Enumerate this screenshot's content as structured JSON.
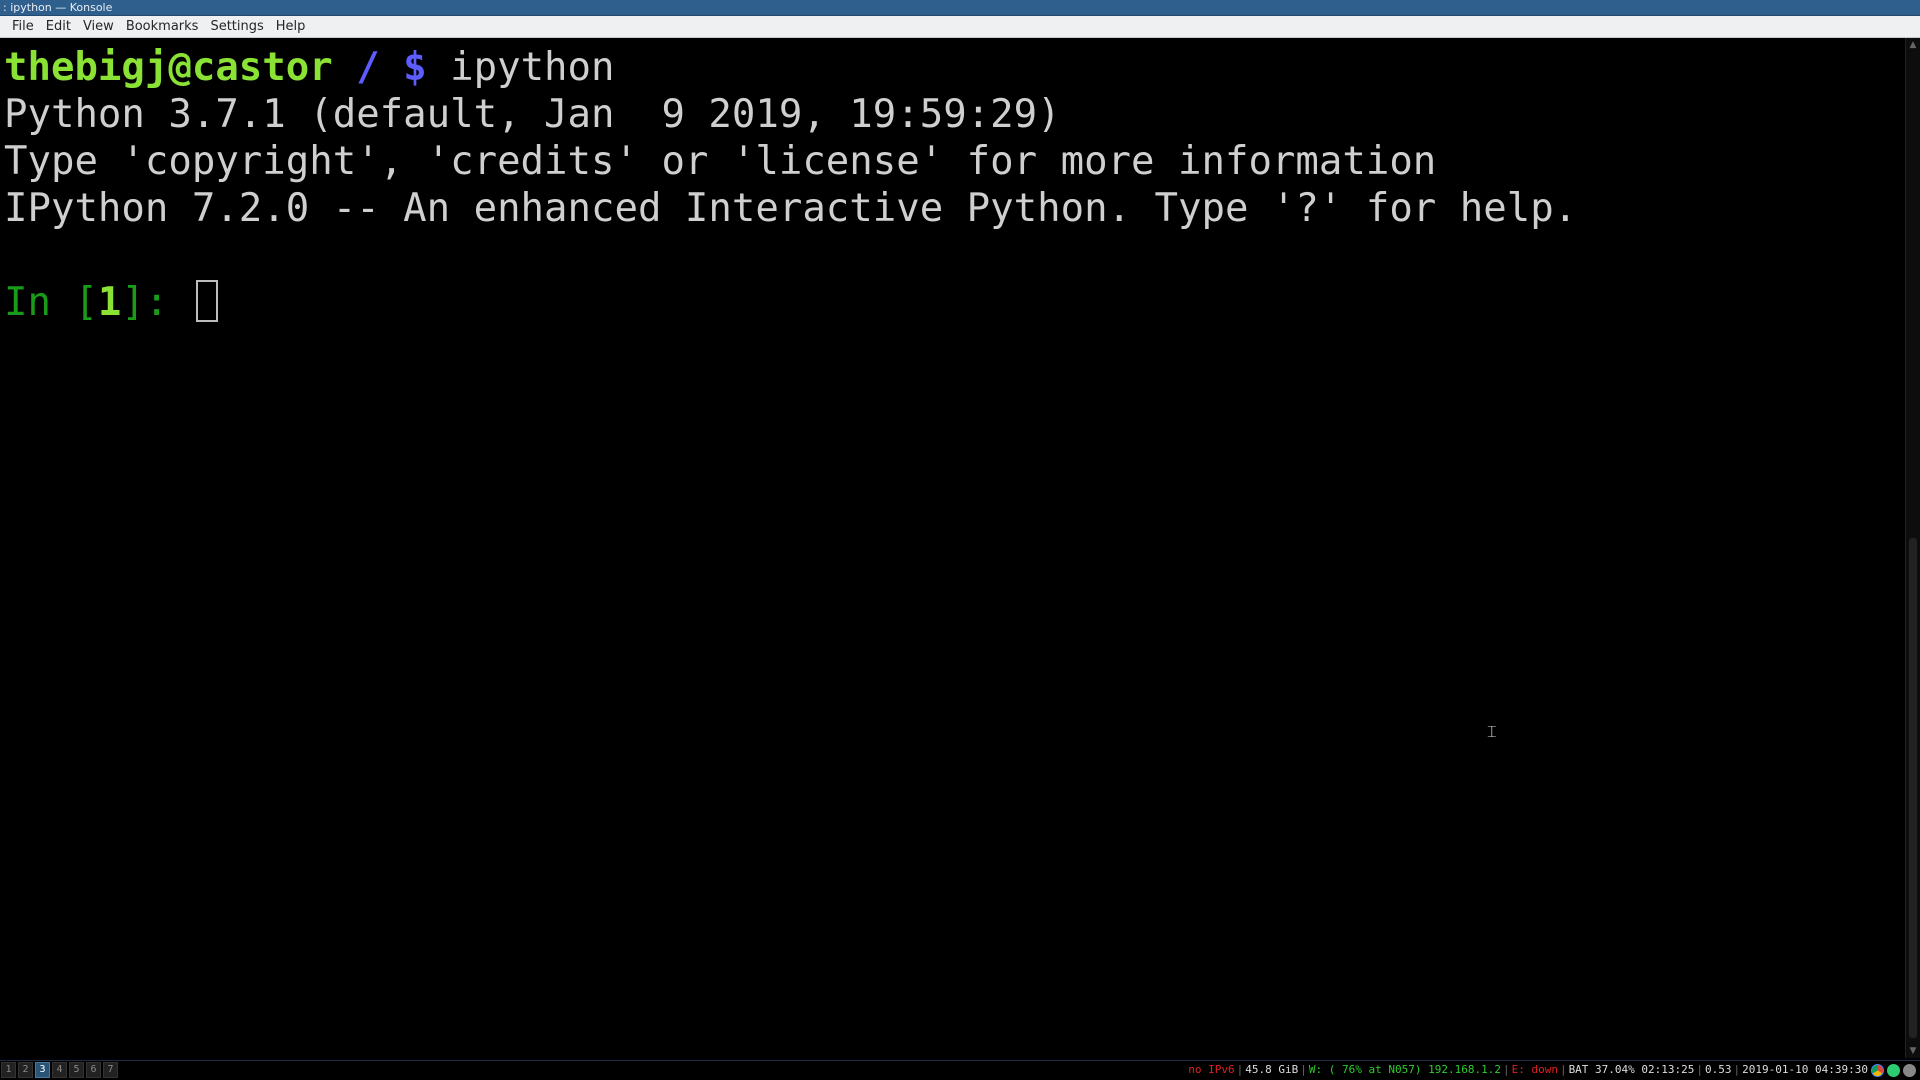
{
  "window": {
    "title": ": ipython — Konsole"
  },
  "menubar": {
    "items": [
      "File",
      "Edit",
      "View",
      "Bookmarks",
      "Settings",
      "Help"
    ]
  },
  "terminal": {
    "prompt_user": "thebigj@castor",
    "prompt_path": " / $",
    "command": " ipython",
    "lines": [
      "Python 3.7.1 (default, Jan  9 2019, 19:59:29)",
      "Type 'copyright', 'credits' or 'license' for more information",
      "IPython 7.2.0 -- An enhanced Interactive Python. Type '?' for help."
    ],
    "input_prefix": "In [",
    "input_number": "1",
    "input_suffix": "]: "
  },
  "statusbar": {
    "workspaces": [
      "1",
      "2",
      "3",
      "4",
      "5",
      "6",
      "7"
    ],
    "focused_workspace": "3",
    "ipv6": "no IPv6",
    "disk": "45.8 GiB",
    "wifi": "W: ( 76% at N057) 192.168.1.2",
    "ethernet": "E: down",
    "battery": "BAT 37.04% 02:13:25",
    "load": "0.53",
    "datetime": "2019-01-10 04:39:30",
    "colors": {
      "ipv6": "#e02020",
      "wifi": "#2ecc2e",
      "ethernet": "#e02020",
      "default": "#dddddd"
    },
    "tray_icons": [
      "chrome-icon",
      "network-icon",
      "status-icon"
    ]
  },
  "colors": {
    "titlebar": "#2f5f8c",
    "prompt_user": "#8ae234",
    "prompt_path": "#5c5cff",
    "ipython_in": "#1a9c1a",
    "terminal_text": "#cfcfcf"
  }
}
